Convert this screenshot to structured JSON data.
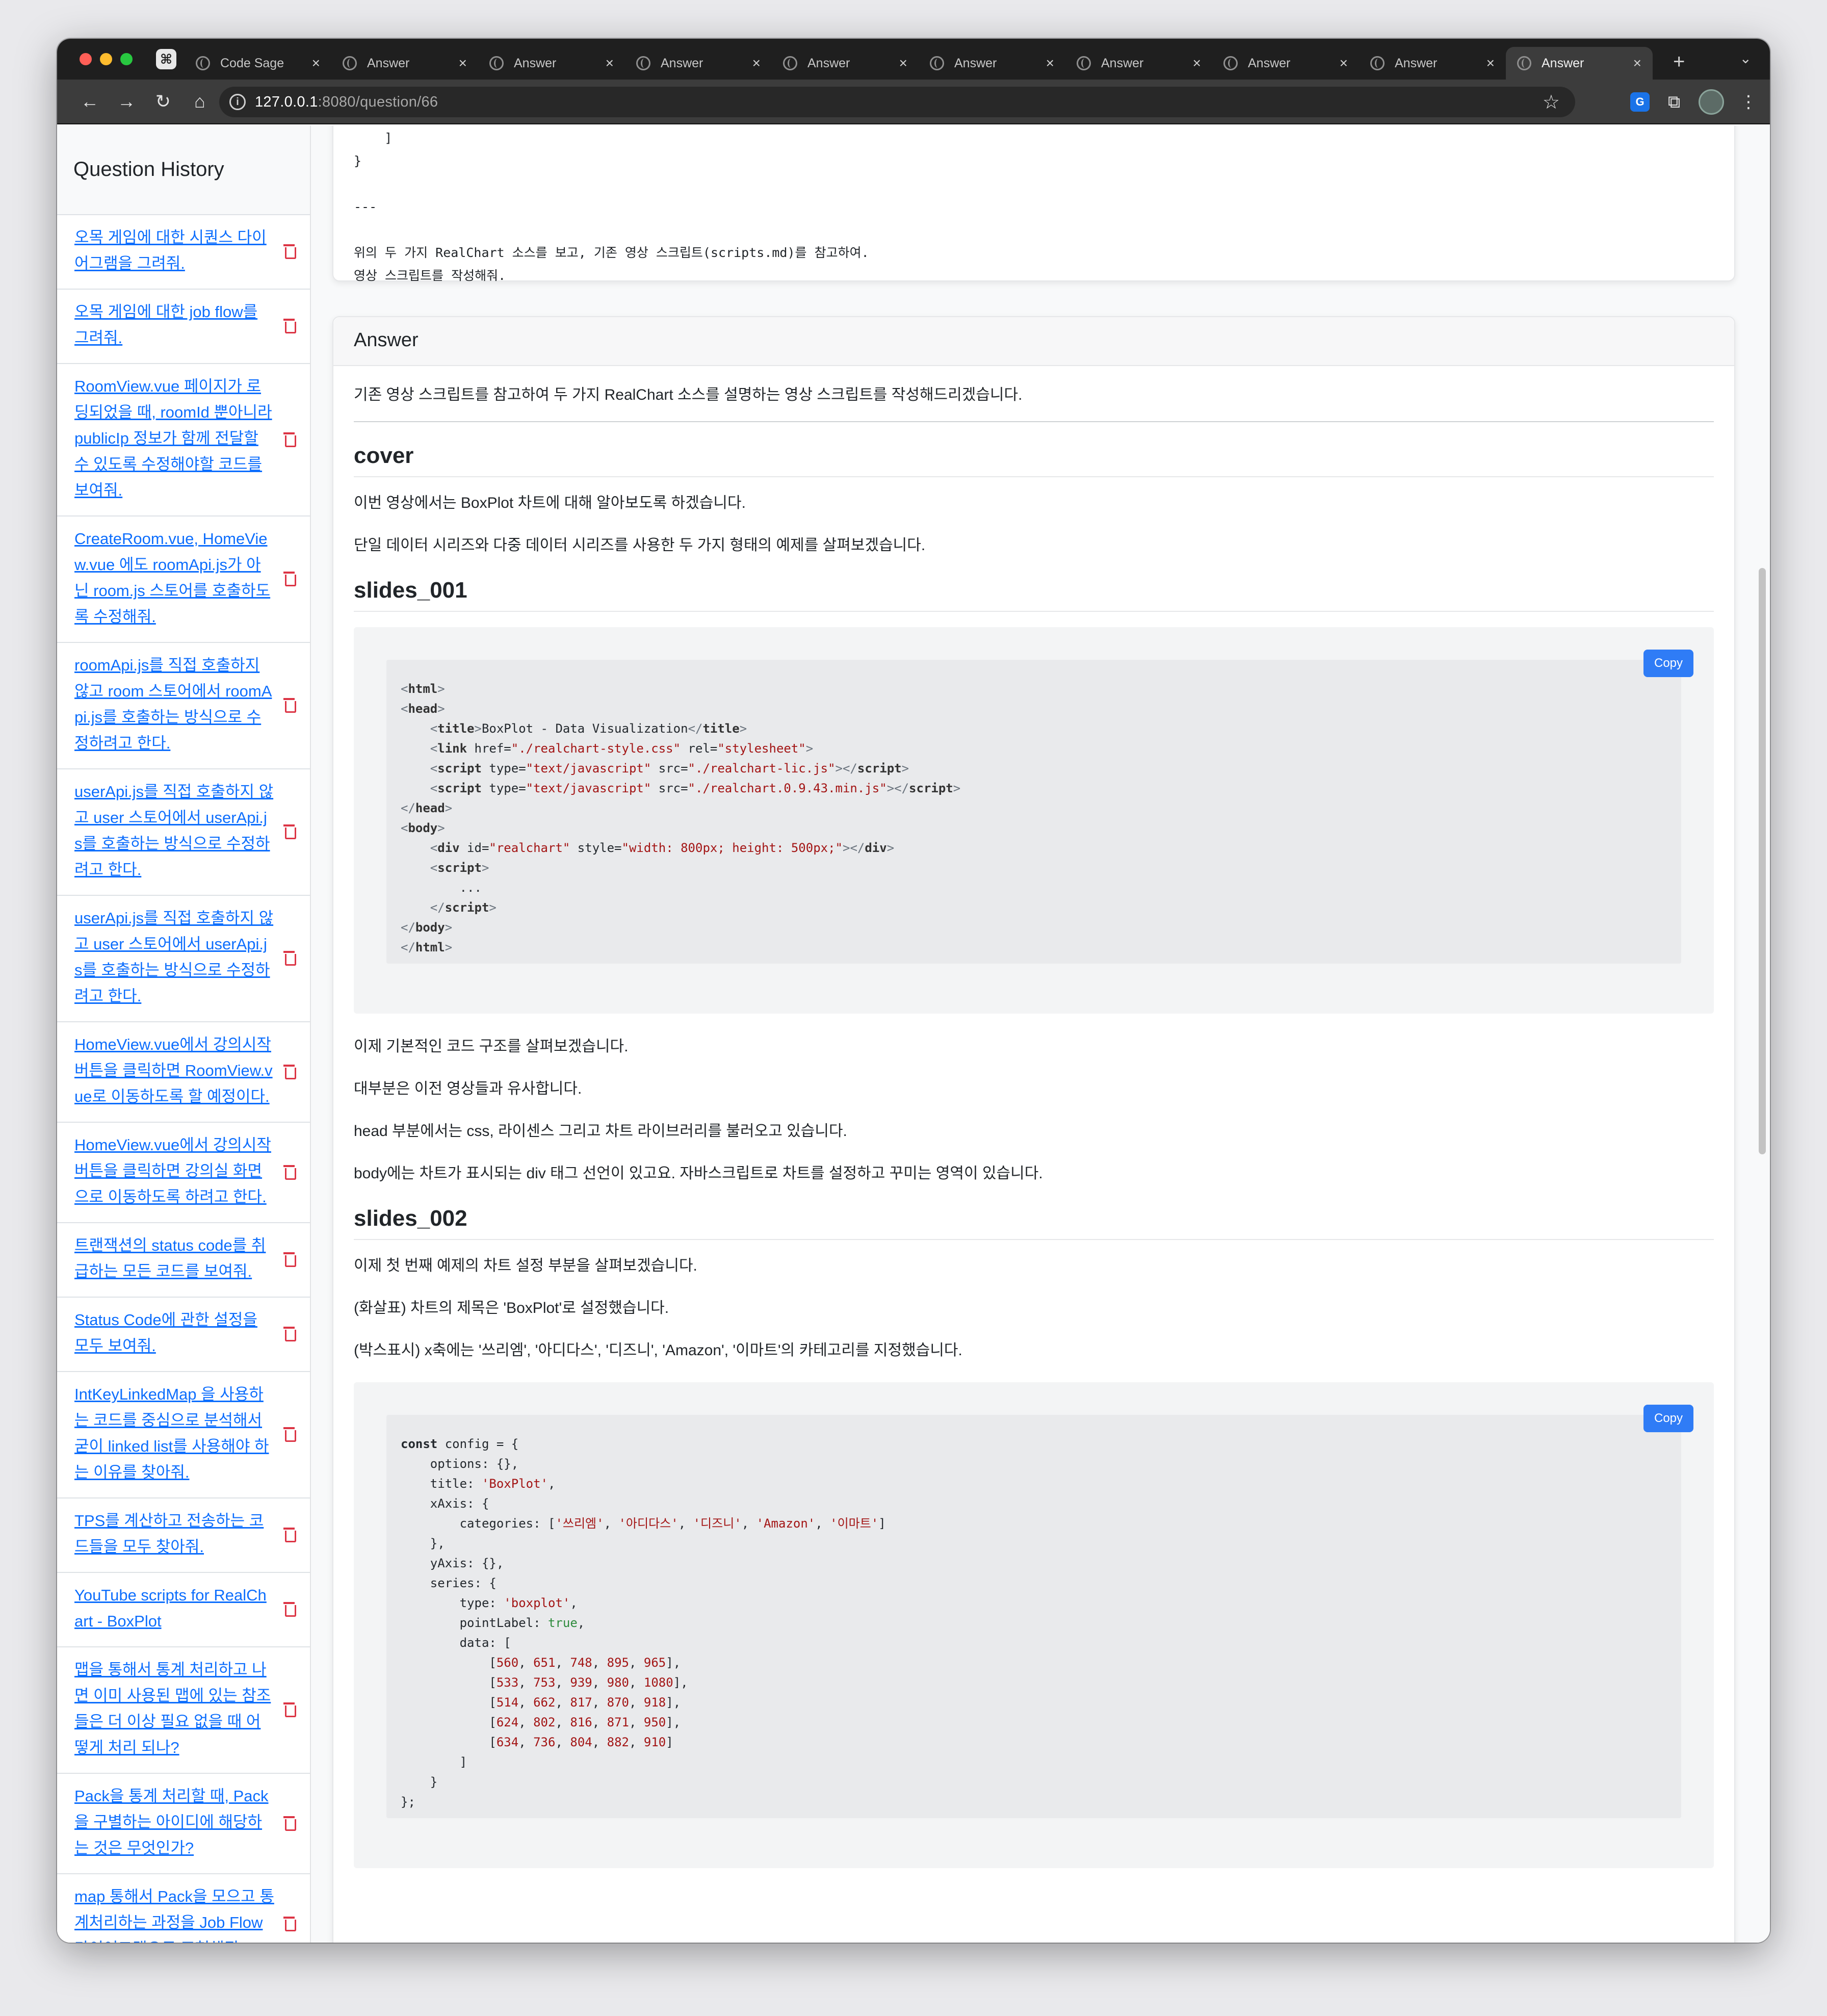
{
  "browser": {
    "tabs": [
      {
        "label": "Code Sage",
        "active": false
      },
      {
        "label": "Answer",
        "active": false
      },
      {
        "label": "Answer",
        "active": false
      },
      {
        "label": "Answer",
        "active": false
      },
      {
        "label": "Answer",
        "active": false
      },
      {
        "label": "Answer",
        "active": false
      },
      {
        "label": "Answer",
        "active": false
      },
      {
        "label": "Answer",
        "active": false
      },
      {
        "label": "Answer",
        "active": false
      },
      {
        "label": "Answer",
        "active": true
      }
    ],
    "url_host": "127.0.0.1",
    "url_path": ":8080/question/66"
  },
  "sidebar": {
    "title": "Question History",
    "items": [
      "오목 게임에 대한 시퀀스 다이어그램을 그려줘.",
      "오목 게임에 대한 job flow를 그려줘.",
      "RoomView.vue 페이지가 로딩되었을 때, roomId 뿐아니라 publicIp 정보가 함께 전달할 수 있도록 수정해야할 코드를 보여줘.",
      "CreateRoom.vue, HomeView.vue 에도 roomApi.js가 아닌 room.js 스토어를 호출하도록 수정해줘.",
      "roomApi.js를 직접 호출하지 않고 room 스토어에서 roomApi.js를 호출하는 방식으로 수정하려고 한다.",
      "userApi.js를 직접 호출하지 않고 user 스토어에서 userApi.js를 호출하는 방식으로 수정하려고 한다.",
      "userApi.js를 직접 호출하지 않고 user 스토어에서 userApi.js를 호출하는 방식으로 수정하려고 한다.",
      "HomeView.vue에서 강의시작 버튼을 클릭하면 RoomView.vue로 이동하도록 할 예정이다.",
      "HomeView.vue에서 강의시작 버튼을 클릭하면 강의실 화면으로 이동하도록 하려고 한다.",
      "트랜잭션의 status code를 취급하는 모든 코드를 보여줘.",
      "Status Code에 관한 설정을 모두 보여줘.",
      "IntKeyLinkedMap 을 사용하는 코드를 중심으로 분석해서 굳이 linked list를 사용해야 하는 이유를 찾아줘.",
      "TPS를 계산하고 전송하는 코드들을 모두 찾아줘.",
      "YouTube scripts for RealChart - BoxPlot",
      "맵을 통해서 통계 처리하고 나면 이미 사용된 맵에 있는 참조들은 더 이상 필요 없을 때 어떻게 처리 되나?",
      "Pack을 통계 처리할 때, Pack을 구별하는 아이디에 해당하는 것은 무엇인가?",
      "map 통해서 Pack을 모으고 통계처리하는 과정을 Job Flow 다이어그램으로 표현해줘.",
      "map 통해서 Pack을 모으고 통"
    ]
  },
  "question": {
    "tail_lines": [
      "    ]",
      "}",
      "",
      "---",
      "",
      "위의 두 가지 RealChart 소스를 보고, 기존 영상 스크립트(scripts.md)를 참고하여.",
      "영상 스크립트를 작성해줘."
    ]
  },
  "answer": {
    "header": "Answer",
    "intro": "기존 영상 스크립트를 참고하여 두 가지 RealChart 소스를 설명하는 영상 스크립트를 작성해드리겠습니다.",
    "cover": {
      "heading": "cover",
      "p1": "이번 영상에서는 BoxPlot 차트에 대해 알아보도록 하겠습니다.",
      "p2": "단일 데이터 시리즈와 다중 데이터 시리즈를 사용한 두 가지 형태의 예제를 살펴보겠습니다."
    },
    "s1": {
      "heading": "slides_001",
      "copy": "Copy",
      "p1": "이제 기본적인 코드 구조를 살펴보겠습니다.",
      "p2": "대부분은 이전 영상들과 유사합니다.",
      "p3": "head 부분에서는 css, 라이센스 그리고 차트 라이브러리를 불러오고 있습니다.",
      "p4": "body에는 차트가 표시되는 div 태그 선언이 있고요. 자바스크립트로 차트를 설정하고 꾸미는 영역이 있습니다."
    },
    "s2": {
      "heading": "slides_002",
      "copy": "Copy",
      "p1": "이제 첫 번째 예제의 차트 설정 부분을 살펴보겠습니다.",
      "p2": "(화살표) 차트의 제목은 'BoxPlot'로 설정했습니다.",
      "p3": "(박스표시) x축에는 '쓰리엠', '아디다스', '디즈니', 'Amazon', '이마트'의 카테고리를 지정했습니다."
    }
  },
  "code1": [
    [
      [
        "p",
        "<"
      ],
      [
        "t",
        "html"
      ],
      [
        "p",
        ">"
      ]
    ],
    [
      [
        "p",
        "<"
      ],
      [
        "t",
        "head"
      ],
      [
        "p",
        ">"
      ]
    ],
    [
      [
        "x",
        "    "
      ],
      [
        "p",
        "<"
      ],
      [
        "t",
        "title"
      ],
      [
        "p",
        ">"
      ],
      [
        "x",
        "BoxPlot - Data Visualization"
      ],
      [
        "p",
        "</"
      ],
      [
        "t",
        "title"
      ],
      [
        "p",
        ">"
      ]
    ],
    [
      [
        "x",
        "    "
      ],
      [
        "p",
        "<"
      ],
      [
        "t",
        "link"
      ],
      [
        "x",
        " href="
      ],
      [
        "s",
        "\"./realchart-style.css\""
      ],
      [
        "x",
        " rel="
      ],
      [
        "s",
        "\"stylesheet\""
      ],
      [
        "p",
        ">"
      ]
    ],
    [
      [
        "x",
        "    "
      ],
      [
        "p",
        "<"
      ],
      [
        "t",
        "script"
      ],
      [
        "x",
        " type="
      ],
      [
        "s",
        "\"text/javascript\""
      ],
      [
        "x",
        " src="
      ],
      [
        "s",
        "\"./realchart-lic.js\""
      ],
      [
        "p",
        "></"
      ],
      [
        "t",
        "script"
      ],
      [
        "p",
        ">"
      ]
    ],
    [
      [
        "x",
        "    "
      ],
      [
        "p",
        "<"
      ],
      [
        "t",
        "script"
      ],
      [
        "x",
        " type="
      ],
      [
        "s",
        "\"text/javascript\""
      ],
      [
        "x",
        " src="
      ],
      [
        "s",
        "\"./realchart.0.9.43.min.js\""
      ],
      [
        "p",
        "></"
      ],
      [
        "t",
        "script"
      ],
      [
        "p",
        ">"
      ]
    ],
    [
      [
        "p",
        "</"
      ],
      [
        "t",
        "head"
      ],
      [
        "p",
        ">"
      ]
    ],
    [
      [
        "p",
        "<"
      ],
      [
        "t",
        "body"
      ],
      [
        "p",
        ">"
      ]
    ],
    [
      [
        "x",
        "    "
      ],
      [
        "p",
        "<"
      ],
      [
        "t",
        "div"
      ],
      [
        "x",
        " id="
      ],
      [
        "s",
        "\"realchart\""
      ],
      [
        "x",
        " style="
      ],
      [
        "s",
        "\"width: 800px; height: 500px;\""
      ],
      [
        "p",
        "></"
      ],
      [
        "t",
        "div"
      ],
      [
        "p",
        ">"
      ]
    ],
    [
      [
        "x",
        "    "
      ],
      [
        "p",
        "<"
      ],
      [
        "t",
        "script"
      ],
      [
        "p",
        ">"
      ]
    ],
    [
      [
        "x",
        "        ..."
      ]
    ],
    [
      [
        "x",
        "    "
      ],
      [
        "p",
        "</"
      ],
      [
        "t",
        "script"
      ],
      [
        "p",
        ">"
      ]
    ],
    [
      [
        "p",
        "</"
      ],
      [
        "t",
        "body"
      ],
      [
        "p",
        ">"
      ]
    ],
    [
      [
        "p",
        "</"
      ],
      [
        "t",
        "html"
      ],
      [
        "p",
        ">"
      ]
    ]
  ],
  "code2": [
    [
      [
        "k",
        "const"
      ],
      [
        "x",
        " config = {"
      ]
    ],
    [
      [
        "x",
        "    options: {},"
      ]
    ],
    [
      [
        "x",
        "    title: "
      ],
      [
        "s",
        "'BoxPlot'"
      ],
      [
        "x",
        ","
      ]
    ],
    [
      [
        "x",
        "    xAxis: {"
      ]
    ],
    [
      [
        "x",
        "        categories: ["
      ],
      [
        "s",
        "'쓰리엠'"
      ],
      [
        "x",
        ", "
      ],
      [
        "s",
        "'아디다스'"
      ],
      [
        "x",
        ", "
      ],
      [
        "s",
        "'디즈니'"
      ],
      [
        "x",
        ", "
      ],
      [
        "s",
        "'Amazon'"
      ],
      [
        "x",
        ", "
      ],
      [
        "s",
        "'이마트'"
      ],
      [
        "x",
        "]"
      ]
    ],
    [
      [
        "x",
        "    },"
      ]
    ],
    [
      [
        "x",
        "    yAxis: {},"
      ]
    ],
    [
      [
        "x",
        "    series: {"
      ]
    ],
    [
      [
        "x",
        "        type: "
      ],
      [
        "s",
        "'boxplot'"
      ],
      [
        "x",
        ","
      ]
    ],
    [
      [
        "x",
        "        pointLabel: "
      ],
      [
        "b",
        "true"
      ],
      [
        "x",
        ","
      ]
    ],
    [
      [
        "x",
        "        data: ["
      ]
    ],
    [
      [
        "x",
        "            ["
      ],
      [
        "n",
        "560"
      ],
      [
        "x",
        ", "
      ],
      [
        "n",
        "651"
      ],
      [
        "x",
        ", "
      ],
      [
        "n",
        "748"
      ],
      [
        "x",
        ", "
      ],
      [
        "n",
        "895"
      ],
      [
        "x",
        ", "
      ],
      [
        "n",
        "965"
      ],
      [
        "x",
        "],"
      ]
    ],
    [
      [
        "x",
        "            ["
      ],
      [
        "n",
        "533"
      ],
      [
        "x",
        ", "
      ],
      [
        "n",
        "753"
      ],
      [
        "x",
        ", "
      ],
      [
        "n",
        "939"
      ],
      [
        "x",
        ", "
      ],
      [
        "n",
        "980"
      ],
      [
        "x",
        ", "
      ],
      [
        "n",
        "1080"
      ],
      [
        "x",
        "],"
      ]
    ],
    [
      [
        "x",
        "            ["
      ],
      [
        "n",
        "514"
      ],
      [
        "x",
        ", "
      ],
      [
        "n",
        "662"
      ],
      [
        "x",
        ", "
      ],
      [
        "n",
        "817"
      ],
      [
        "x",
        ", "
      ],
      [
        "n",
        "870"
      ],
      [
        "x",
        ", "
      ],
      [
        "n",
        "918"
      ],
      [
        "x",
        "],"
      ]
    ],
    [
      [
        "x",
        "            ["
      ],
      [
        "n",
        "624"
      ],
      [
        "x",
        ", "
      ],
      [
        "n",
        "802"
      ],
      [
        "x",
        ", "
      ],
      [
        "n",
        "816"
      ],
      [
        "x",
        ", "
      ],
      [
        "n",
        "871"
      ],
      [
        "x",
        ", "
      ],
      [
        "n",
        "950"
      ],
      [
        "x",
        "],"
      ]
    ],
    [
      [
        "x",
        "            ["
      ],
      [
        "n",
        "634"
      ],
      [
        "x",
        ", "
      ],
      [
        "n",
        "736"
      ],
      [
        "x",
        ", "
      ],
      [
        "n",
        "804"
      ],
      [
        "x",
        ", "
      ],
      [
        "n",
        "882"
      ],
      [
        "x",
        ", "
      ],
      [
        "n",
        "910"
      ],
      [
        "x",
        "]"
      ]
    ],
    [
      [
        "x",
        "        ]"
      ]
    ],
    [
      [
        "x",
        "    }"
      ]
    ],
    [
      [
        "x",
        "};"
      ]
    ]
  ]
}
